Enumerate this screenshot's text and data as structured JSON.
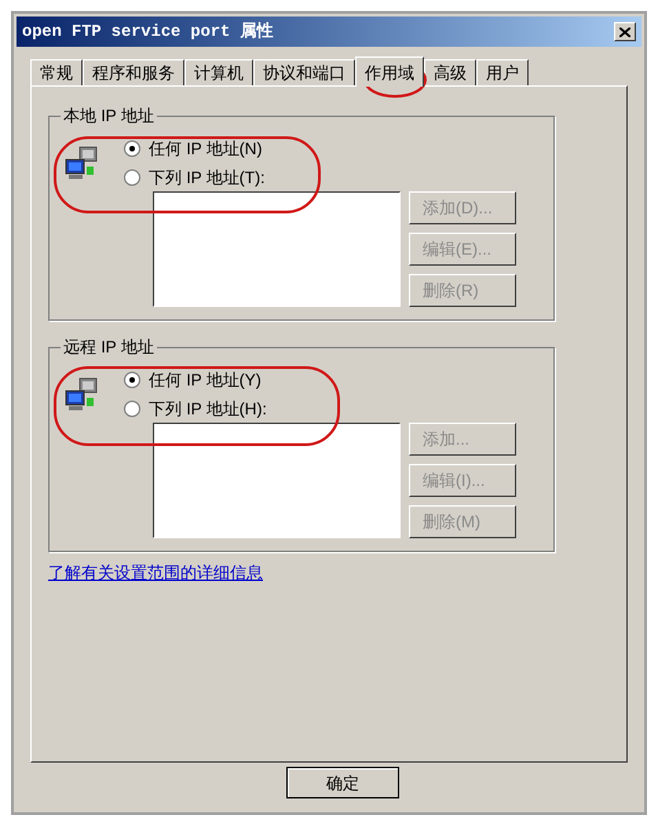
{
  "window": {
    "title": "open FTP service port 属性"
  },
  "tabs": [
    {
      "label": "常规",
      "selected": false
    },
    {
      "label": "程序和服务",
      "selected": false
    },
    {
      "label": "计算机",
      "selected": false
    },
    {
      "label": "协议和端口",
      "selected": false
    },
    {
      "label": "作用域",
      "selected": true
    },
    {
      "label": "高级",
      "selected": false
    },
    {
      "label": "用户",
      "selected": false
    }
  ],
  "groups": [
    {
      "legend": "本地 IP 地址",
      "options": [
        {
          "label": "任何 IP 地址(N)",
          "selected": true
        },
        {
          "label": "下列 IP 地址(T):",
          "selected": false
        }
      ],
      "buttons": [
        {
          "label": "添加(D)...",
          "disabled": true
        },
        {
          "label": "编辑(E)...",
          "disabled": true
        },
        {
          "label": "删除(R)",
          "disabled": true
        }
      ]
    },
    {
      "legend": "远程 IP 地址",
      "options": [
        {
          "label": "任何 IP 地址(Y)",
          "selected": true
        },
        {
          "label": "下列 IP 地址(H):",
          "selected": false
        }
      ],
      "buttons": [
        {
          "label": "添加...",
          "disabled": true
        },
        {
          "label": "编辑(I)...",
          "disabled": true
        },
        {
          "label": "删除(M)",
          "disabled": true
        }
      ]
    }
  ],
  "link": "了解有关设置范围的详细信息",
  "footer_buttons": [
    {
      "label": "确定"
    }
  ]
}
